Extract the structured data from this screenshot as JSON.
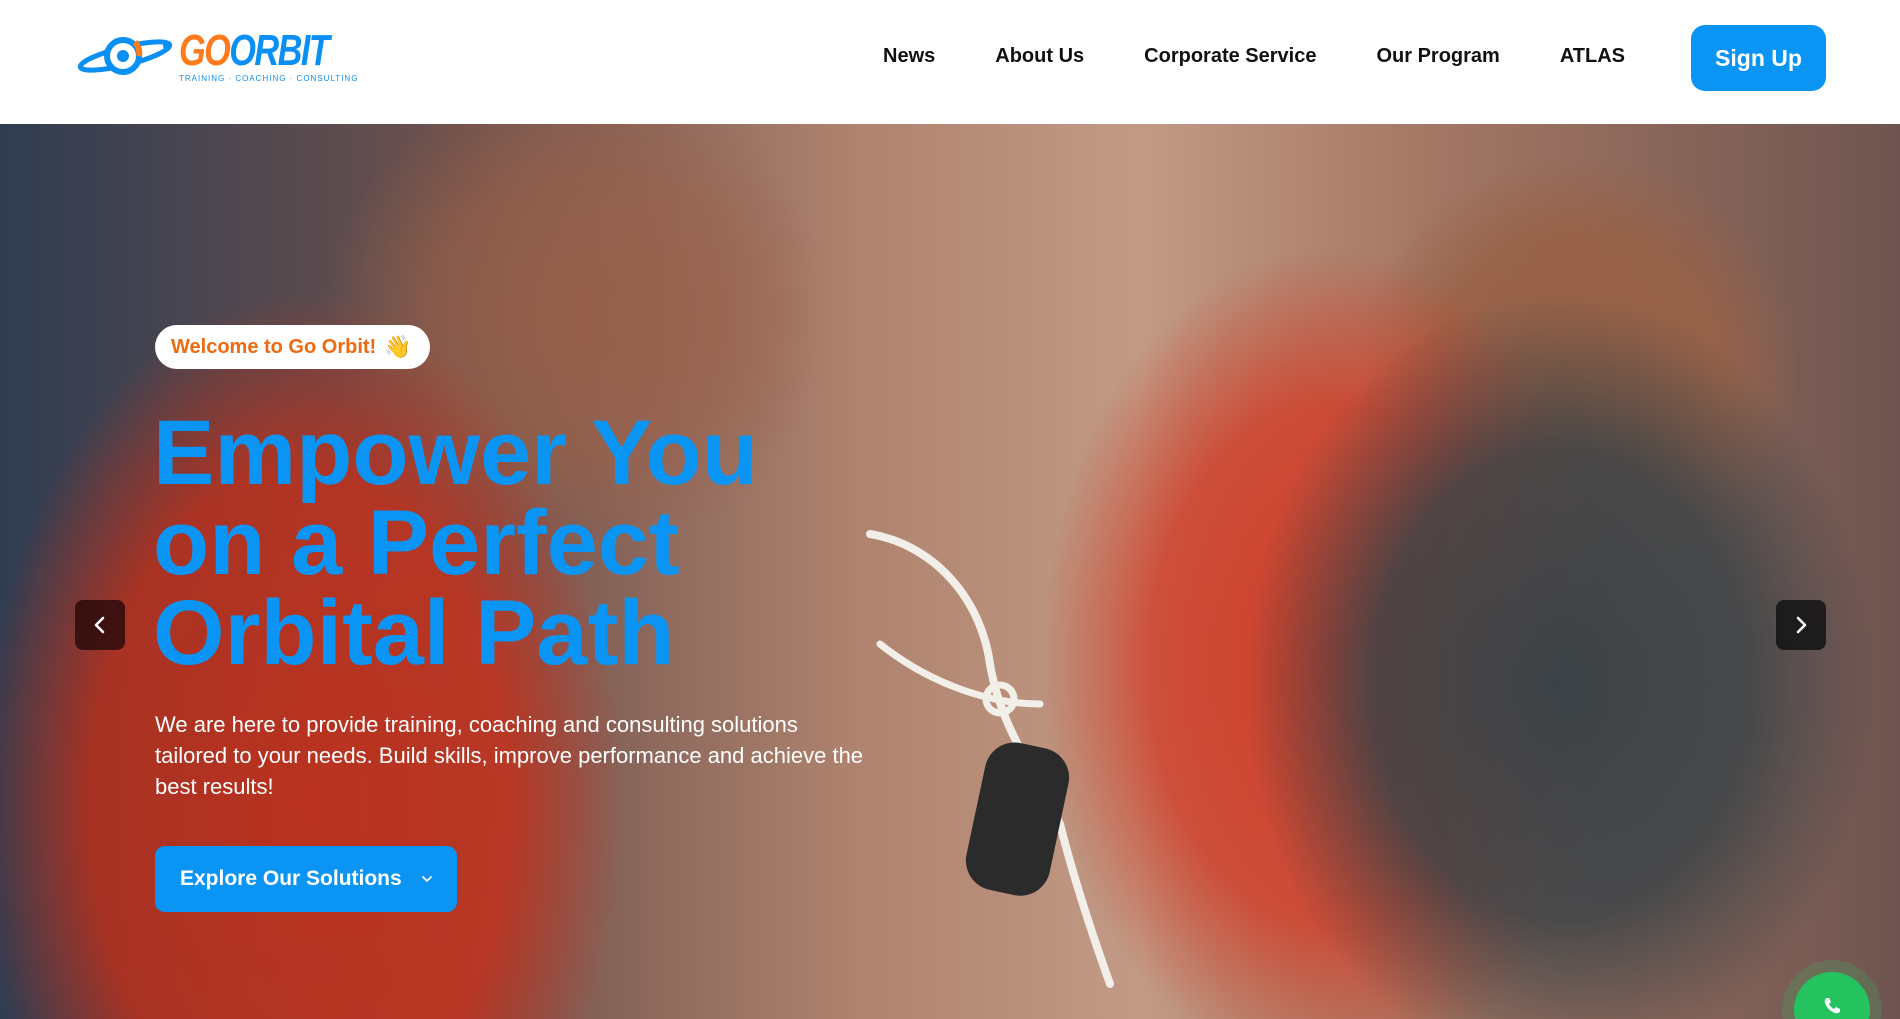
{
  "header": {
    "logo": {
      "word_go": "GO",
      "word_orbit": "ORBIT",
      "tagline": "TRAINING · COACHING · CONSULTING"
    },
    "nav": [
      {
        "label": "News"
      },
      {
        "label": "About Us"
      },
      {
        "label": "Corporate Service"
      },
      {
        "label": "Our Program"
      },
      {
        "label": "ATLAS"
      }
    ],
    "signup_label": "Sign Up"
  },
  "hero": {
    "welcome": "Welcome to Go Orbit!",
    "welcome_icon": "👋",
    "headline_lines": [
      "Empower You",
      "on a Perfect",
      "Orbital Path"
    ],
    "subtext": "We are here to provide training, coaching and consulting solutions tailored to your needs. Build skills, improve performance and achieve the best results!",
    "cta_label": "Explore Our Solutions"
  },
  "colors": {
    "brand_blue": "#0a95f5",
    "brand_orange": "#ee6a10",
    "whatsapp_green": "#25c35f"
  },
  "icons": {
    "prev": "chevron-left-icon",
    "next": "chevron-right-icon",
    "cta": "chevron-down-icon",
    "chat": "whatsapp-icon"
  }
}
